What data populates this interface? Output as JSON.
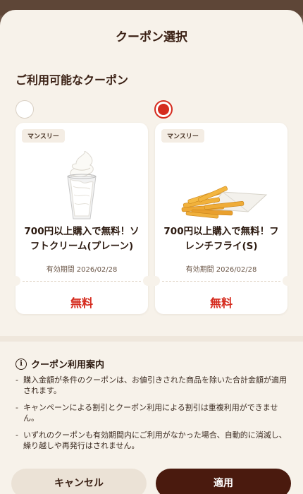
{
  "sheet": {
    "title": "クーポン選択",
    "section_title": "ご利用可能なクーポン"
  },
  "coupons": [
    {
      "tag": "マンスリー",
      "title": "700円以上購入で無料！ソフトクリーム(プレーン)",
      "validity": "有効期間 2026/02/28",
      "price": "無料",
      "selected": false,
      "icon": "soft-serve-icon"
    },
    {
      "tag": "マンスリー",
      "title": "700円以上購入で無料！フレンチフライ(S)",
      "validity": "有効期間 2026/02/28",
      "price": "無料",
      "selected": true,
      "icon": "french-fries-icon"
    }
  ],
  "info": {
    "icon": "info-icon",
    "title": "クーポン利用案内",
    "notes": [
      "購入金額が条件のクーポンは、お値引きされた商品を除いた合計金額が適用されます。",
      "キャンペーンによる割引とクーポン利用による割引は重複利用ができません。",
      "いずれのクーポンも有効期間内にご利用がなかった場合、自動的に消滅し、繰り越しや再発行はされません。"
    ]
  },
  "buttons": {
    "cancel": "キャンセル",
    "apply": "適用"
  },
  "colors": {
    "accent_red": "#d52b1e",
    "primary_brown": "#4a1a0e",
    "sheet_bg": "#f7f2ea"
  }
}
